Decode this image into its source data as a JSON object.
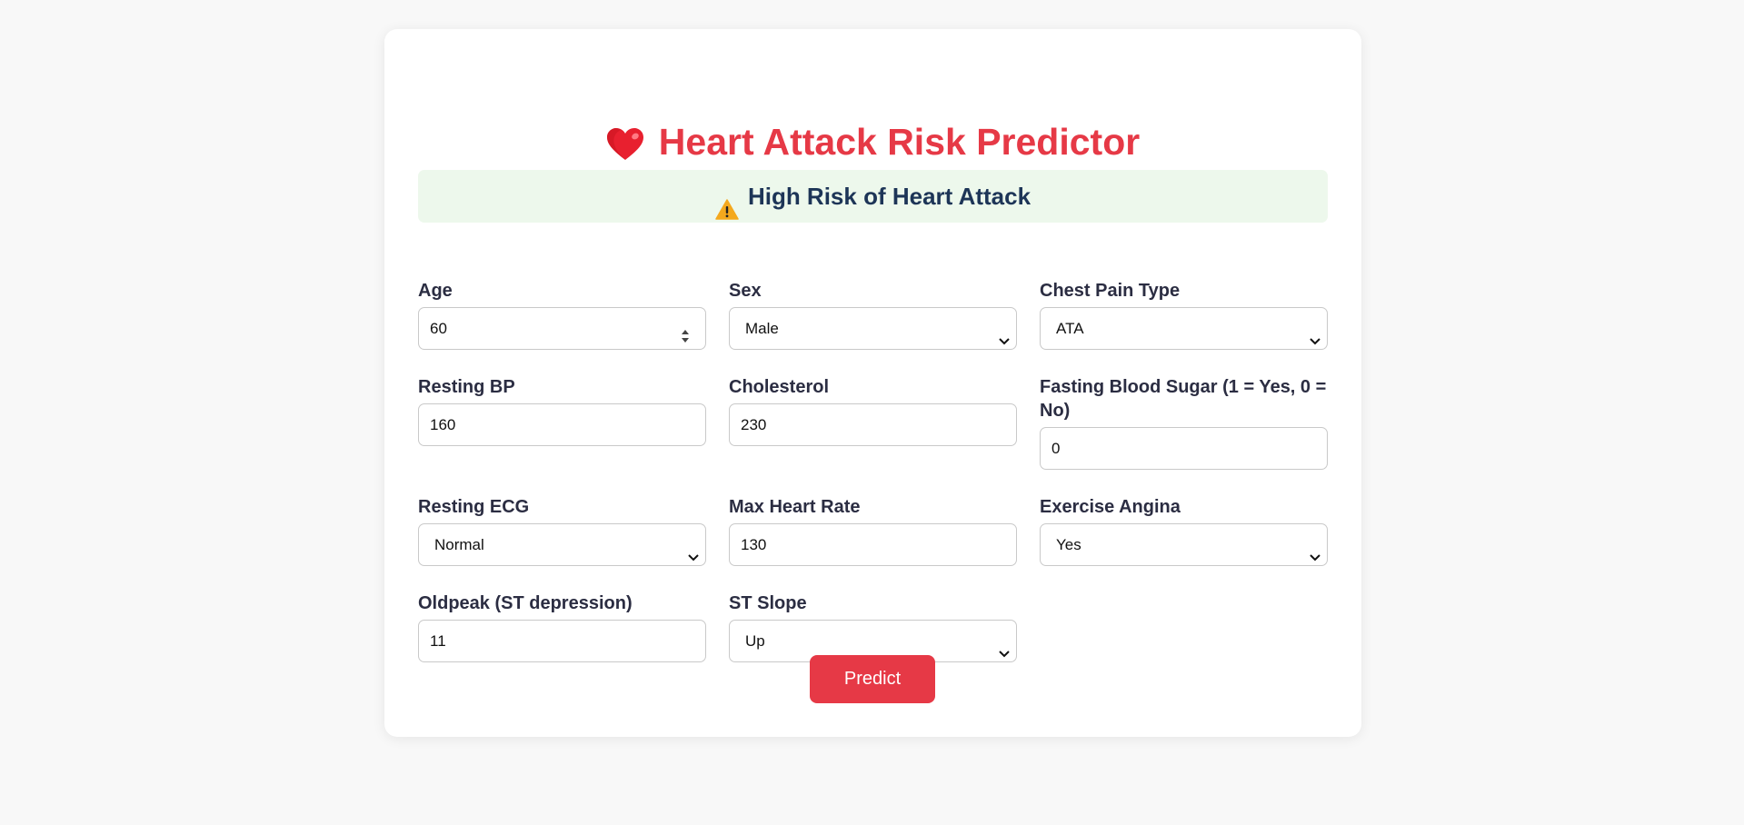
{
  "app": {
    "title": "Heart Attack Risk Predictor"
  },
  "result": {
    "text": "High Risk of Heart Attack"
  },
  "form": {
    "age": {
      "label": "Age",
      "value": "60"
    },
    "sex": {
      "label": "Sex",
      "value": "Male"
    },
    "chest_pain": {
      "label": "Chest Pain Type",
      "value": "ATA"
    },
    "resting_bp": {
      "label": "Resting BP",
      "value": "160"
    },
    "cholesterol": {
      "label": "Cholesterol",
      "value": "230"
    },
    "fasting_bs": {
      "label": "Fasting Blood Sugar (1 = Yes, 0 = No)",
      "value": "0"
    },
    "resting_ecg": {
      "label": "Resting ECG",
      "value": "Normal"
    },
    "max_hr": {
      "label": "Max Heart Rate",
      "value": "130"
    },
    "exercise_angina": {
      "label": "Exercise Angina",
      "value": "Yes"
    },
    "oldpeak": {
      "label": "Oldpeak (ST depression)",
      "value": "11"
    },
    "st_slope": {
      "label": "ST Slope",
      "value": "Up"
    }
  },
  "actions": {
    "predict_label": "Predict"
  },
  "icons": {
    "title_icon": "heart-icon",
    "result_icon": "warning-icon"
  },
  "colors": {
    "accent": "#e63946",
    "heading_dark": "#1d3557",
    "banner_bg": "#edf8ec",
    "page_bg": "#f8f8f8"
  }
}
